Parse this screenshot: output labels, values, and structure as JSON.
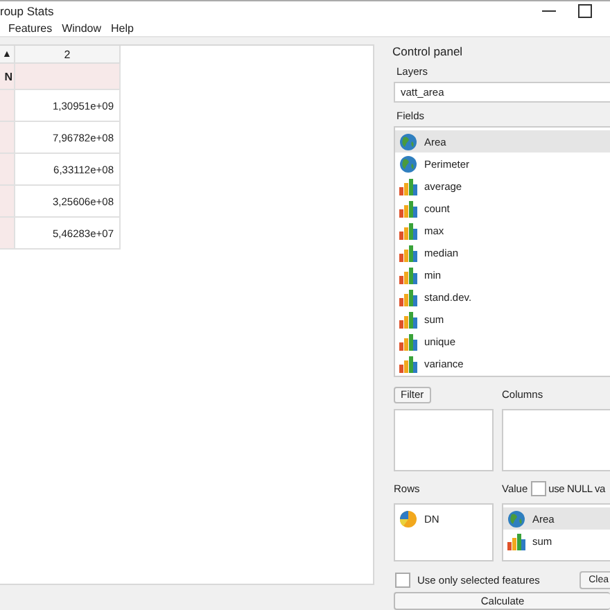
{
  "window": {
    "title": "roup Stats"
  },
  "menu": [
    "Features",
    "Window",
    "Help"
  ],
  "table": {
    "sort_indicator": "▲",
    "columns": [
      "2"
    ],
    "group_row": {
      "label": "N"
    },
    "rows": [
      {
        "value": "1,30951e+09"
      },
      {
        "value": "7,96782e+08"
      },
      {
        "value": "6,33112e+08"
      },
      {
        "value": "3,25606e+08"
      },
      {
        "value": "5,46283e+07"
      }
    ]
  },
  "control_panel": {
    "title": "Control panel",
    "layers_label": "Layers",
    "layer": "vatt_area",
    "fields_label": "Fields",
    "fields": [
      {
        "label": "Area",
        "kind": "geometry",
        "selected": true
      },
      {
        "label": "Perimeter",
        "kind": "geometry",
        "selected": false
      },
      {
        "label": "average",
        "kind": "stat",
        "selected": false
      },
      {
        "label": "count",
        "kind": "stat",
        "selected": false
      },
      {
        "label": "max",
        "kind": "stat",
        "selected": false
      },
      {
        "label": "median",
        "kind": "stat",
        "selected": false
      },
      {
        "label": "min",
        "kind": "stat",
        "selected": false
      },
      {
        "label": "stand.dev.",
        "kind": "stat",
        "selected": false
      },
      {
        "label": "sum",
        "kind": "stat",
        "selected": false
      },
      {
        "label": "unique",
        "kind": "stat",
        "selected": false
      },
      {
        "label": "variance",
        "kind": "stat",
        "selected": false
      }
    ],
    "filter_button": "Filter",
    "columns_label": "Columns",
    "rows_label": "Rows",
    "rows": [
      {
        "label": "DN",
        "kind": "group",
        "selected": false
      }
    ],
    "value_label": "Value",
    "use_null": {
      "label": "use NULL va",
      "checked": false
    },
    "values": [
      {
        "label": "Area",
        "kind": "geometry",
        "selected": true
      },
      {
        "label": "sum",
        "kind": "stat",
        "selected": false
      }
    ],
    "selected_only": {
      "label": "Use only selected features",
      "checked": false
    },
    "clear_button": "Clea",
    "calculate_button": "Calculate"
  }
}
